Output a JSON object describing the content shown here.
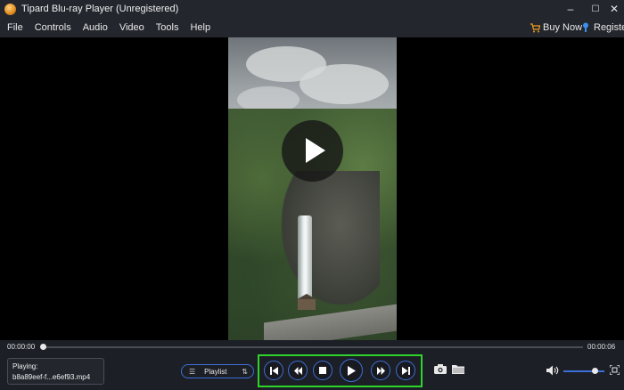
{
  "window": {
    "title": "Tipard Blu-ray Player (Unregistered)",
    "minimize": "–",
    "maximize": "☐",
    "close": "✕"
  },
  "menu": {
    "items": [
      "File",
      "Controls",
      "Audio",
      "Video",
      "Tools",
      "Help"
    ],
    "buy_now": "Buy Now",
    "register": "Register"
  },
  "playback": {
    "current_time": "00:00:00",
    "total_time": "00:00:06",
    "progress": 0.0,
    "volume": 0.75
  },
  "now_playing": {
    "label": "Playing:",
    "file": "b8a89eef-f...e6ef93.mp4"
  },
  "playlist_button": {
    "label": "Playlist"
  },
  "colors": {
    "accent": "#3c6fd6",
    "highlight": "#2fd42a",
    "background": "#1c1f26"
  }
}
